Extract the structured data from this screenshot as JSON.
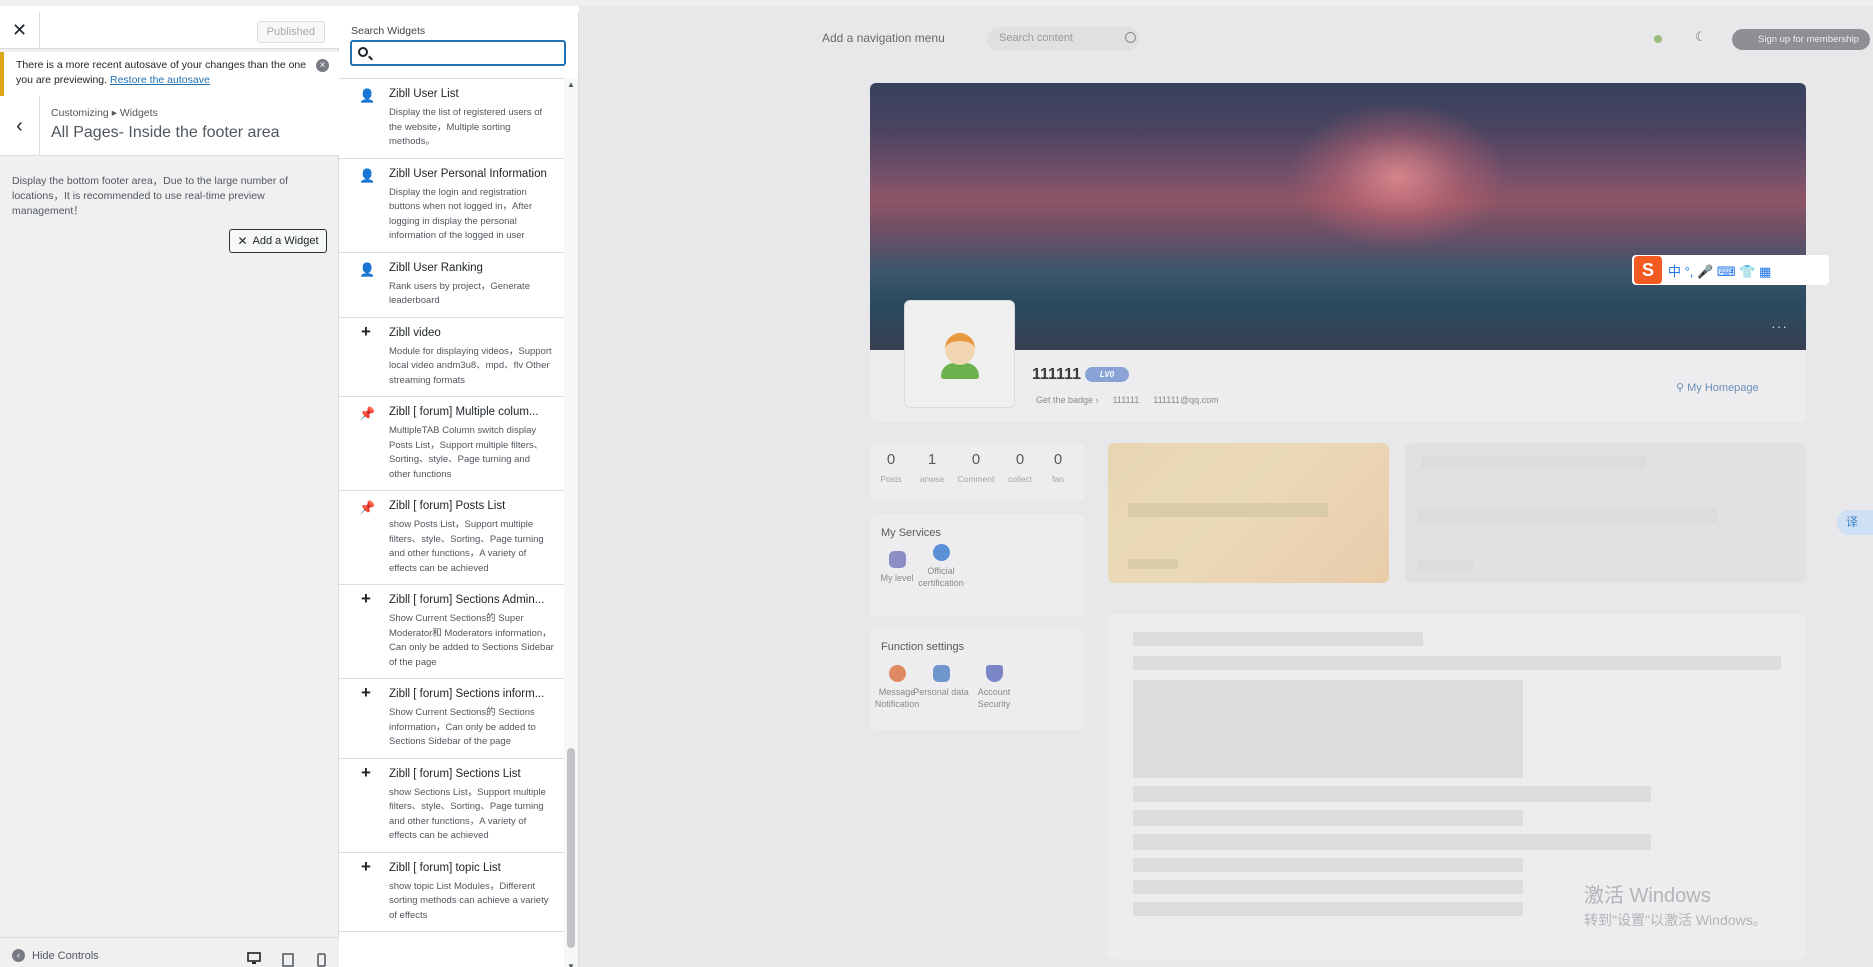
{
  "customizer": {
    "close_label": "✕",
    "publish_label": "Published",
    "notice": {
      "text": "There is a more recent autosave of your changes than the one you are previewing.",
      "link": "Restore the autosave"
    },
    "breadcrumb": "Customizing ▸ Widgets",
    "section_title": "All Pages- Inside the footer area",
    "description": "Display the bottom footer area，Due to the large number of locations，It is recommended to use real-time preview management！",
    "add_widget_label": "Add a Widget",
    "hide_controls_label": "Hide Controls"
  },
  "widget_panel": {
    "search_label": "Search Widgets",
    "search_value": "",
    "widgets": [
      {
        "icon": "user-icon",
        "glyph": "👤",
        "title": "Zibll User List",
        "desc": "Display the list of registered users of the website，Multiple sorting methods。"
      },
      {
        "icon": "user-icon",
        "glyph": "👤",
        "title": "Zibll User Personal Information",
        "desc": "Display the login and registration buttons when not logged in，After logging in display the personal information of the logged in user"
      },
      {
        "icon": "user-icon",
        "glyph": "👤",
        "title": "Zibll User Ranking",
        "desc": "Rank users by project，Generate leaderboard"
      },
      {
        "icon": "plus-icon",
        "glyph": "+",
        "title": "Zibll video",
        "desc": "Module for displaying videos，Support local video andm3u8、mpd、flv Other streaming formats"
      },
      {
        "icon": "pin-icon",
        "glyph": "📌",
        "title": "Zibll [ forum] Multiple colum...",
        "desc": "MultipleTAB Column switch display Posts List，Support multiple filters、Sorting、style、Page turning and other functions"
      },
      {
        "icon": "pin-icon",
        "glyph": "📌",
        "title": "Zibll [ forum] Posts List",
        "desc": "show Posts List，Support multiple filters、style、Sorting、Page turning and other functions，A variety of effects can be achieved"
      },
      {
        "icon": "plus-icon",
        "glyph": "+",
        "title": "Zibll [ forum] Sections Admin...",
        "desc": "Show Current Sections的 Super Moderator和 Moderators information，Can only be added to Sections Sidebar of the page"
      },
      {
        "icon": "plus-icon",
        "glyph": "+",
        "title": "Zibll [ forum] Sections inform...",
        "desc": "Show Current Sections的 Sections information，Can only be added to Sections Sidebar of the page"
      },
      {
        "icon": "plus-icon",
        "glyph": "+",
        "title": "Zibll [ forum] Sections List",
        "desc": "show Sections List，Support multiple filters、style、Sorting、Page turning and other functions，A variety of effects can be achieved"
      },
      {
        "icon": "plus-icon",
        "glyph": "+",
        "title": "Zibll [ forum] topic List",
        "desc": "show topic List Modules，Different sorting methods can achieve a variety of effects"
      }
    ]
  },
  "preview": {
    "nav_menu": "Add a navigation menu",
    "search_placeholder": "Search content",
    "signup_label": "Sign up for membership",
    "username": "111111",
    "level_badge": "LV0",
    "meta": {
      "badge": "Get the badge ›",
      "id": "111111",
      "email": "111111@qq.com"
    },
    "homepage_label": "My Homepage",
    "stats": [
      {
        "num": "0",
        "label": "Posts"
      },
      {
        "num": "1",
        "label": "anwse"
      },
      {
        "num": "0",
        "label": "Comment"
      },
      {
        "num": "0",
        "label": "collect"
      },
      {
        "num": "0",
        "label": "fan"
      }
    ],
    "services_title": "My Services",
    "services": [
      "My level",
      "Official certification"
    ],
    "function_title": "Function settings",
    "functions": [
      "Message Notification",
      "Personal data",
      "Account Security"
    ],
    "ime_bar": "中 °, 🎤 ⌨ 👕 ▦",
    "translate_label": "译",
    "activate_windows": {
      "line1": "激活 Windows",
      "line2": "转到\"设置\"以激活 Windows。"
    }
  },
  "colors": {
    "accent": "#2271b1",
    "notice": "#dba617",
    "overlay": "#e8e8ea"
  }
}
